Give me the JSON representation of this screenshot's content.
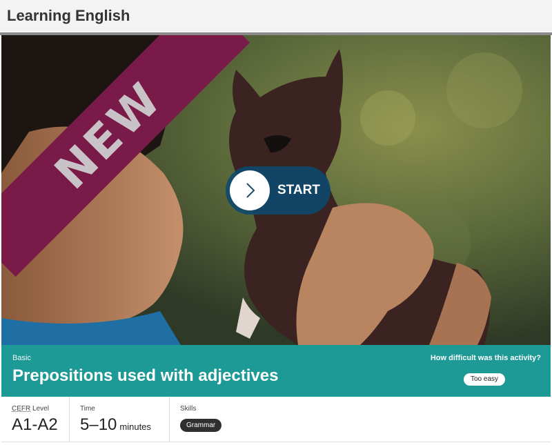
{
  "header": {
    "title": "Learning English"
  },
  "hero": {
    "ribbon_text": "NEW",
    "start_label": "START",
    "colors": {
      "ribbon": "#7a1a48",
      "start_button": "#0c4a6e"
    },
    "icons": {
      "start": "chevron-right-icon"
    }
  },
  "banner": {
    "level": "Basic",
    "title": "Prepositions used with adjectives",
    "difficulty_question": "How difficult was this activity?",
    "difficulty_answer": "Too easy",
    "color": "#1d9a96"
  },
  "info": {
    "cefr_label_abbr": "CEFR",
    "cefr_label_rest": " Level",
    "cefr_value": "A1-A2",
    "time_label": "Time",
    "time_value": "5–10",
    "time_unit": "minutes",
    "skills_label": "Skills",
    "skill": "Grammar"
  }
}
